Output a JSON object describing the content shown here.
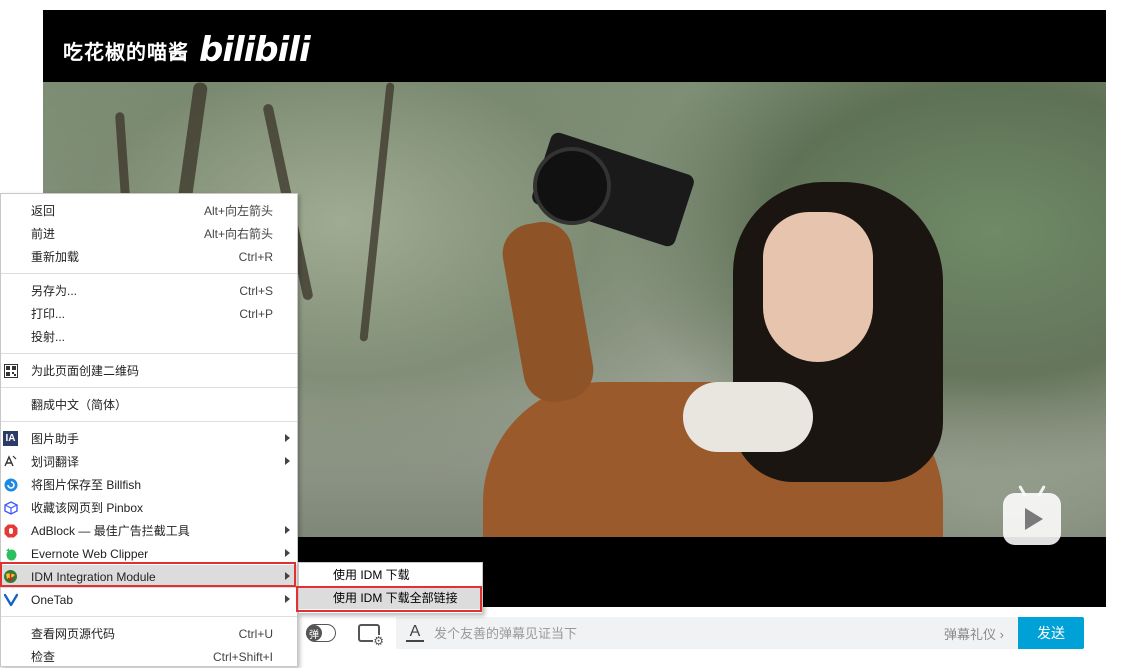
{
  "player": {
    "uploader_name": "吃花椒的喵酱",
    "logo_text": "bilibili"
  },
  "danmaku": {
    "toggle_label": "弹",
    "placeholder": "发个友善的弹幕见证当下",
    "style_icon_text": "A",
    "etiquette_label": "弹幕礼仪 ›",
    "send_label": "发送"
  },
  "context_menu": {
    "groups": [
      [
        {
          "label": "返回",
          "shortcut": "Alt+向左箭头"
        },
        {
          "label": "前进",
          "shortcut": "Alt+向右箭头"
        },
        {
          "label": "重新加载",
          "shortcut": "Ctrl+R"
        }
      ],
      [
        {
          "label": "另存为...",
          "shortcut": "Ctrl+S"
        },
        {
          "label": "打印...",
          "shortcut": "Ctrl+P"
        },
        {
          "label": "投射...",
          "shortcut": ""
        }
      ],
      [
        {
          "label": "为此页面创建二维码",
          "icon": "qr-code-icon"
        }
      ],
      [
        {
          "label": "翻成中文（简体）"
        }
      ],
      [
        {
          "label": "图片助手",
          "icon": "image-assistant-icon",
          "submenu": true
        },
        {
          "label": "划词翻译",
          "icon": "translate-icon",
          "submenu": true
        },
        {
          "label": "将图片保存至 Billfish",
          "icon": "billfish-icon"
        },
        {
          "label": "收藏该网页到 Pinbox",
          "icon": "pinbox-icon"
        },
        {
          "label": "AdBlock — 最佳广告拦截工具",
          "icon": "adblock-icon",
          "submenu": true
        },
        {
          "label": "Evernote Web Clipper",
          "icon": "evernote-icon",
          "submenu": true
        },
        {
          "label": "IDM Integration Module",
          "icon": "idm-icon",
          "submenu": true,
          "highlighted": true
        },
        {
          "label": "OneTab",
          "icon": "onetab-icon",
          "submenu": true
        }
      ],
      [
        {
          "label": "查看网页源代码",
          "shortcut": "Ctrl+U"
        },
        {
          "label": "检查",
          "shortcut": "Ctrl+Shift+I"
        }
      ]
    ],
    "icon_text": {
      "image_assistant": "IA"
    }
  },
  "idm_submenu": {
    "items": [
      {
        "label": "使用 IDM 下载"
      },
      {
        "label": "使用 IDM 下载全部链接",
        "highlighted": true
      }
    ]
  },
  "colors": {
    "send_button": "#00a1d6",
    "highlight_border": "#e03030",
    "menu_highlight": "#dcdcdc"
  }
}
